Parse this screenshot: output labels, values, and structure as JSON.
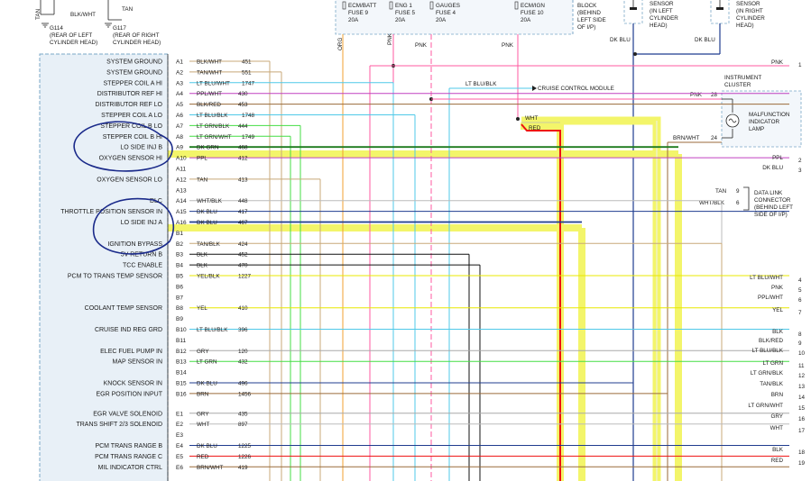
{
  "header": {
    "tan_label": "TAN",
    "blk_wht_label": "BLK/WHT",
    "tan_right_label": "TAN",
    "ground_left": [
      "G114",
      "(REAR OF LEFT",
      "CYLINDER HEAD)"
    ],
    "ground_right": [
      "G117",
      "(REAR OF RIGHT",
      "CYLINDER HEAD)"
    ],
    "fuse1": [
      "ECM/BATT",
      "FUSE 9",
      "20A"
    ],
    "fuse2": [
      "ENG 1",
      "FUSE 5",
      "20A"
    ],
    "fuse3": [
      "GAUGES",
      "FUSE 4",
      "20A"
    ],
    "fuse4": [
      "ECM/IGN",
      "FUSE 10",
      "20A"
    ],
    "block_note": [
      "BLOCK",
      "(BEHIND",
      "LEFT SIDE",
      "OF I/P)"
    ],
    "sensor_left": [
      "SENSOR",
      "(IN LEFT",
      "CYLINDER",
      "HEAD)"
    ],
    "sensor_right": [
      "SENSOR",
      "(IN RIGHT",
      "CYLINDER",
      "HEAD)"
    ],
    "dk_blu_1": "DK BLU",
    "dk_blu_2": "DK BLU"
  },
  "vertical_labels": {
    "org": "ORG",
    "pnk1": "PNK",
    "pnk2": "PNK",
    "pnk3": "PNK"
  },
  "pcm_pins": [
    {
      "function": "SYSTEM GROUND",
      "pin": "A1",
      "wire": "BLK/WHT",
      "circuit": "451"
    },
    {
      "function": "SYSTEM GROUND",
      "pin": "A2",
      "wire": "TAN/WHT",
      "circuit": "551"
    },
    {
      "function": "STEPPER COIL A HI",
      "pin": "A3",
      "wire": "LT BLU/WHT",
      "circuit": "1747"
    },
    {
      "function": "DISTRIBUTOR REF HI",
      "pin": "A4",
      "wire": "PPL/WHT",
      "circuit": "430"
    },
    {
      "function": "DISTRIBUTOR REF LO",
      "pin": "A5",
      "wire": "BLK/RED",
      "circuit": "453"
    },
    {
      "function": "STEPPER COIL A LO",
      "pin": "A6",
      "wire": "LT BLU/BLK",
      "circuit": "1748"
    },
    {
      "function": "STEPPER COIL B LO",
      "pin": "A7",
      "wire": "LT GRN/BLK",
      "circuit": "444"
    },
    {
      "function": "STEPPER COIL B HI",
      "pin": "A8",
      "wire": "LT GRN/WHT",
      "circuit": "1749"
    },
    {
      "function": "LO SIDE INJ B",
      "pin": "A9",
      "wire": "DK GRN",
      "circuit": "468"
    },
    {
      "function": "OXYGEN SENSOR HI",
      "pin": "A10",
      "wire": "PPL",
      "circuit": "412"
    },
    {
      "function": "",
      "pin": "A11",
      "wire": "",
      "circuit": ""
    },
    {
      "function": "OXYGEN SENSOR LO",
      "pin": "A12",
      "wire": "TAN",
      "circuit": "413"
    },
    {
      "function": "",
      "pin": "A13",
      "wire": "",
      "circuit": ""
    },
    {
      "function": "DLC",
      "pin": "A14",
      "wire": "WHT/BLK",
      "circuit": "448"
    },
    {
      "function": "THROTTLE POSITION SENSOR IN",
      "pin": "A15",
      "wire": "DK BLU",
      "circuit": "417"
    },
    {
      "function": "LO SIDE INJ A",
      "pin": "A16",
      "wire": "DK BLU",
      "circuit": "467"
    },
    {
      "function": "",
      "pin": "B1",
      "wire": "",
      "circuit": ""
    },
    {
      "function": "IGNITION BYPASS",
      "pin": "B2",
      "wire": "TAN/BLK",
      "circuit": "424"
    },
    {
      "function": "5V RETURN B",
      "pin": "B3",
      "wire": "BLK",
      "circuit": "452"
    },
    {
      "function": "TCC ENABLE",
      "pin": "B4",
      "wire": "BLK",
      "circuit": "470"
    },
    {
      "function": "PCM TO TRANS TEMP SENSOR",
      "pin": "B5",
      "wire": "YEL/BLK",
      "circuit": "1227"
    },
    {
      "function": "",
      "pin": "B6",
      "wire": "",
      "circuit": ""
    },
    {
      "function": "",
      "pin": "B7",
      "wire": "",
      "circuit": ""
    },
    {
      "function": "COOLANT TEMP SENSOR",
      "pin": "B8",
      "wire": "YEL",
      "circuit": "410"
    },
    {
      "function": "",
      "pin": "B9",
      "wire": "",
      "circuit": ""
    },
    {
      "function": "CRUISE IND REG GRD",
      "pin": "B10",
      "wire": "LT BLU/BLK",
      "circuit": "396"
    },
    {
      "function": "",
      "pin": "B11",
      "wire": "",
      "circuit": ""
    },
    {
      "function": "ELEC FUEL PUMP IN",
      "pin": "B12",
      "wire": "GRY",
      "circuit": "120"
    },
    {
      "function": "MAP SENSOR IN",
      "pin": "B13",
      "wire": "LT GRN",
      "circuit": "432"
    },
    {
      "function": "",
      "pin": "B14",
      "wire": "",
      "circuit": ""
    },
    {
      "function": "KNOCK SENSOR IN",
      "pin": "B15",
      "wire": "DK BLU",
      "circuit": "496"
    },
    {
      "function": "EGR POSITION INPUT",
      "pin": "B16",
      "wire": "BRN",
      "circuit": "1456"
    },
    {
      "function": "EGR VALVE SOLENOID",
      "pin": "E1",
      "wire": "GRY",
      "circuit": "435"
    },
    {
      "function": "TRANS SHIFT 2/3 SOLENOID",
      "pin": "E2",
      "wire": "WHT",
      "circuit": "897"
    },
    {
      "function": "",
      "pin": "E3",
      "wire": "",
      "circuit": ""
    },
    {
      "function": "PCM TRANS RANGE B",
      "pin": "E4",
      "wire": "DK BLU",
      "circuit": "1225"
    },
    {
      "function": "PCM TRANS RANGE C",
      "pin": "E5",
      "wire": "RED",
      "circuit": "1226"
    },
    {
      "function": "MIL INDICATOR CTRL",
      "pin": "E6",
      "wire": "BRN/WHT",
      "circuit": "419"
    }
  ],
  "cruise_label": "CRUISE CONTROL MODULE",
  "lt_blu_blk_top": "LT BLU/BLK",
  "wht_label": "WHT",
  "red_label": "RED",
  "instrument_cluster": {
    "title": [
      "INSTRUMENT",
      "CLUSTER"
    ],
    "pnk_label": "PNK",
    "pnk_pin": "28",
    "brn_label": "BRN/WHT",
    "brn_pin": "24",
    "lamp": [
      "MALFUNCTION",
      "INDICATOR",
      "LAMP"
    ]
  },
  "data_link": {
    "tan": "TAN",
    "tan_pin": "9",
    "wht_blk": "WHT/BLK",
    "wht_blk_pin": "6",
    "desc": [
      "DATA LINK",
      "CONNECTOR",
      "(BEHIND LEFT",
      "SIDE OF I/P)"
    ]
  },
  "right_wires": [
    {
      "label": "PNK",
      "num": "1"
    },
    {
      "label": "PPL",
      "num": "2"
    },
    {
      "label": "DK BLU",
      "num": "3"
    },
    {
      "label": "LT BLU/WHT",
      "num": "4"
    },
    {
      "label": "PNK",
      "num": "5"
    },
    {
      "label": "PPL/WHT",
      "num": "6"
    },
    {
      "label": "YEL",
      "num": "7"
    },
    {
      "label": "BLK",
      "num": "8"
    },
    {
      "label": "BLK/RED",
      "num": "9"
    },
    {
      "label": "LT BLU/BLK",
      "num": "10"
    },
    {
      "label": "LT GRN",
      "num": "11"
    },
    {
      "label": "LT GRN/BLK",
      "num": "12"
    },
    {
      "label": "TAN/BLK",
      "num": "13"
    },
    {
      "label": "BRN",
      "num": "14"
    },
    {
      "label": "LT GRN/WHT",
      "num": "15"
    },
    {
      "label": "GRY",
      "num": "16"
    },
    {
      "label": "WHT",
      "num": "17"
    },
    {
      "label": "BLK",
      "num": "18"
    },
    {
      "label": "RED",
      "num": "19"
    }
  ],
  "colors": {
    "highlight": "#f3f56a",
    "loop": "#1a2a8a",
    "grid": "#7aa7c7",
    "wire_yel": "#e8e800",
    "wire_pnk": "#ff5aa0",
    "wire_ppl": "#c040c0",
    "wire_dkblu": "#1f3c8f",
    "wire_ltblu": "#4fc9e8",
    "wire_ltgrn": "#44dd44",
    "wire_tan": "#c8a878",
    "wire_brn": "#9a6a3a",
    "wire_gry": "#a8a8a8",
    "wire_blk": "#111111",
    "wire_red": "#ee1111",
    "wire_orange": "#f0a030"
  }
}
